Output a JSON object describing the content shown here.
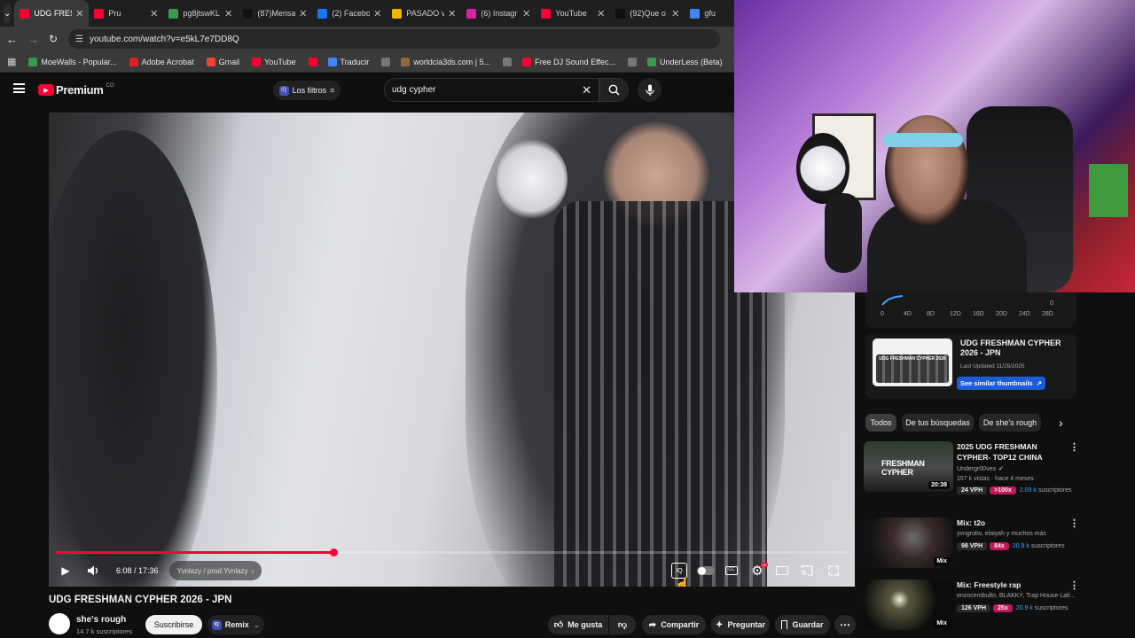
{
  "browser": {
    "tabs": [
      {
        "label": "UDG FRESH",
        "active": true,
        "color": "#ff0033"
      },
      {
        "label": "Pru",
        "active": false,
        "color": "#ff0033"
      },
      {
        "label": "pg8jtswKL",
        "active": false,
        "color": "#3c9a4a"
      },
      {
        "label": "(87)Mensa",
        "active": false,
        "color": "#111111"
      },
      {
        "label": "(2) Facebo",
        "active": false,
        "color": "#1877f2"
      },
      {
        "label": "PASADO v",
        "active": false,
        "color": "#f4b400"
      },
      {
        "label": "(6) Instagr",
        "active": false,
        "color": "#d6249f"
      },
      {
        "label": "YouTube",
        "active": false,
        "color": "#ff0033"
      },
      {
        "label": "(92)Que o",
        "active": false,
        "color": "#111111"
      },
      {
        "label": "gfu",
        "active": false,
        "color": "#4285f4"
      }
    ],
    "url": "youtube.com/watch?v=e5kL7e7DD8Q",
    "bookmarks": [
      {
        "label": "MoeWalls - Popular...",
        "color": "#3c9a4a"
      },
      {
        "label": "Adobe Acrobat",
        "color": "#e02020"
      },
      {
        "label": "Gmail",
        "color": "#ea4335"
      },
      {
        "label": "YouTube",
        "color": "#ff0033"
      },
      {
        "label": "",
        "color": "#ff0033"
      },
      {
        "label": "Traducir",
        "color": "#4285f4"
      },
      {
        "label": "",
        "color": "#777777"
      },
      {
        "label": "worldcia3ds.com | 5...",
        "color": "#8a6d3b"
      },
      {
        "label": "",
        "color": "#777777"
      },
      {
        "label": "Free DJ Sound Effec...",
        "color": "#ff0033"
      },
      {
        "label": "",
        "color": "#777777"
      },
      {
        "label": "UnderLess (Beta)",
        "color": "#3c9a4a"
      }
    ]
  },
  "youtube": {
    "logo_text": "Premium",
    "logo_sup": "CO",
    "filters_label": "Los filtros",
    "search_value": "udg cypher"
  },
  "player": {
    "time": "6:08 / 17:36",
    "chapter": "Yvnlazy / prod.Yvnlazy",
    "progress": 0.35,
    "settings_badge": "HD"
  },
  "video": {
    "title": "UDG FRESHMAN CYPHER 2026 - JPN",
    "channel": "she's rough",
    "subscribers": "14.7 k suscriptores",
    "subscribe_label": "Suscribirse",
    "remix_label": "Remix",
    "like_label": "Me gusta",
    "share_label": "Compartir",
    "ask_label": "Preguntar",
    "save_label": "Guardar"
  },
  "stats_chart": {
    "ticks": [
      "0",
      "4D",
      "8D",
      "12D",
      "16D",
      "20D",
      "24D",
      "28D"
    ],
    "zero_label": "0"
  },
  "thumb_card": {
    "title": "UDG FRESHMAN CYPHER 2026 - JPN",
    "updated": "Last Updated 11/25/2025",
    "button": "See similar thumbnails",
    "thumb_text": "UDG FRESHMAN CYPHER 2026"
  },
  "chips": [
    "Todos",
    "De tus búsquedas",
    "De she's rough"
  ],
  "recommendations": [
    {
      "title": "2025 UDG FRESHMAN CYPHER- TOP12 CHINA",
      "channel": "Undergr00ves",
      "meta": "157 k vistas · hace 4 meses",
      "vph": "24 VPH",
      "mult": ">100x",
      "subs": "2.09 k suscriptores",
      "duration": "20:38",
      "thumb_text": "FRESHMAN CYPHER"
    },
    {
      "title": "Mix: t2o",
      "channel": "yvngrobv, elaiyah y muchos más",
      "meta": "",
      "vph": "98 VPH",
      "mult": "84x",
      "subs": "20.9 k suscriptores",
      "duration": "Mix",
      "thumb_text": ""
    },
    {
      "title": "Mix: Freestyle rap",
      "channel": "enzocerobulto, BLAKKY, Trap House Lati...",
      "meta": "",
      "vph": "126 VPH",
      "mult": "25x",
      "subs": "20.9 k suscriptores",
      "duration": "Mix",
      "thumb_text": ""
    }
  ],
  "colors": {
    "accent_red": "#ff0033",
    "blue_button": "#3ea6ff",
    "magenta_badge": "#c2185b"
  }
}
